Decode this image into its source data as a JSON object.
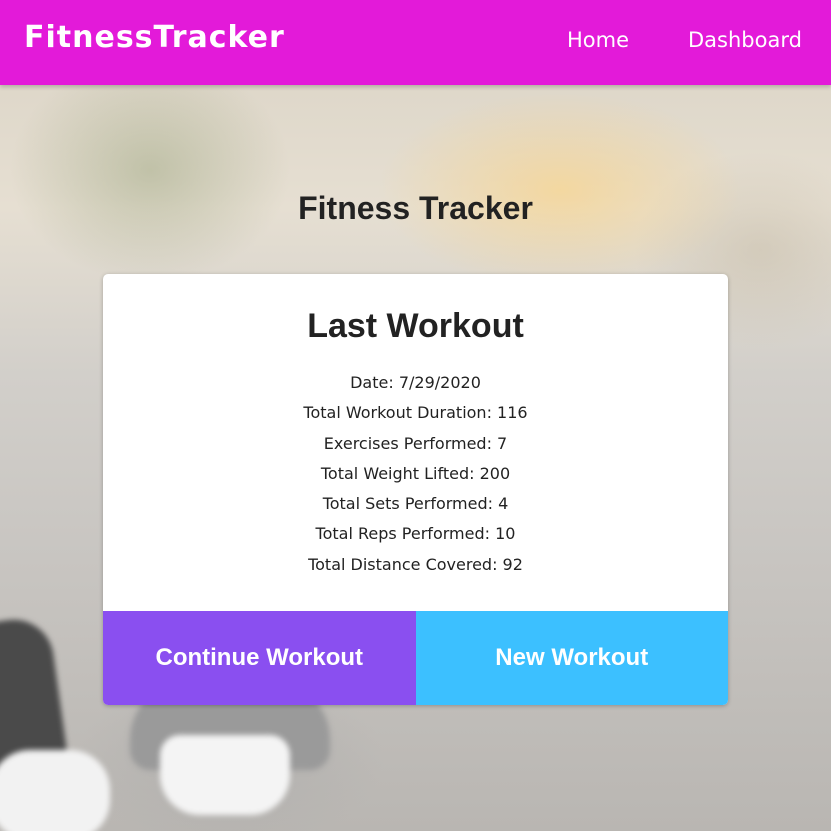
{
  "navbar": {
    "brand": "FitnessTracker",
    "links": [
      "Home",
      "Dashboard"
    ],
    "background_color": "#e31ad9"
  },
  "main": {
    "title": "Fitness Tracker",
    "card": {
      "title": "Last Workout",
      "stats": [
        "Date: 7/29/2020",
        "Total Workout Duration: 116",
        "Exercises Performed: 7",
        "Total Weight Lifted: 200",
        "Total Sets Performed: 4",
        "Total Reps Performed: 10",
        "Total Distance Covered: 92"
      ],
      "buttons": {
        "continue_label": "Continue Workout",
        "continue_color": "#8a4ff0",
        "new_label": "New Workout",
        "new_color": "#3cc0ff"
      }
    }
  }
}
